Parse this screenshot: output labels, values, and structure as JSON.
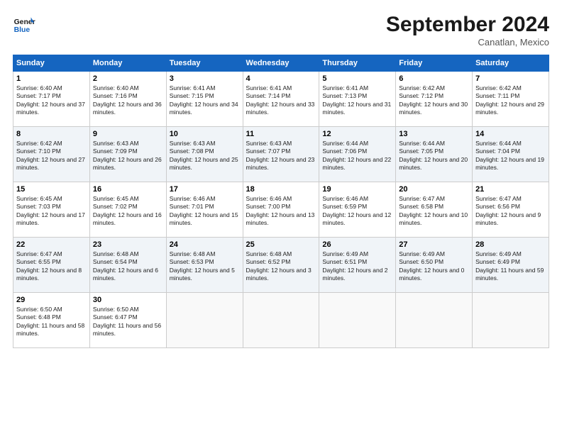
{
  "header": {
    "logo_line1": "General",
    "logo_line2": "Blue",
    "month": "September 2024",
    "location": "Canatlan, Mexico"
  },
  "weekdays": [
    "Sunday",
    "Monday",
    "Tuesday",
    "Wednesday",
    "Thursday",
    "Friday",
    "Saturday"
  ],
  "weeks": [
    [
      {
        "day": "1",
        "sunrise": "6:40 AM",
        "sunset": "7:17 PM",
        "daylight": "12 hours and 37 minutes."
      },
      {
        "day": "2",
        "sunrise": "6:40 AM",
        "sunset": "7:16 PM",
        "daylight": "12 hours and 36 minutes."
      },
      {
        "day": "3",
        "sunrise": "6:41 AM",
        "sunset": "7:15 PM",
        "daylight": "12 hours and 34 minutes."
      },
      {
        "day": "4",
        "sunrise": "6:41 AM",
        "sunset": "7:14 PM",
        "daylight": "12 hours and 33 minutes."
      },
      {
        "day": "5",
        "sunrise": "6:41 AM",
        "sunset": "7:13 PM",
        "daylight": "12 hours and 31 minutes."
      },
      {
        "day": "6",
        "sunrise": "6:42 AM",
        "sunset": "7:12 PM",
        "daylight": "12 hours and 30 minutes."
      },
      {
        "day": "7",
        "sunrise": "6:42 AM",
        "sunset": "7:11 PM",
        "daylight": "12 hours and 29 minutes."
      }
    ],
    [
      {
        "day": "8",
        "sunrise": "6:42 AM",
        "sunset": "7:10 PM",
        "daylight": "12 hours and 27 minutes."
      },
      {
        "day": "9",
        "sunrise": "6:43 AM",
        "sunset": "7:09 PM",
        "daylight": "12 hours and 26 minutes."
      },
      {
        "day": "10",
        "sunrise": "6:43 AM",
        "sunset": "7:08 PM",
        "daylight": "12 hours and 25 minutes."
      },
      {
        "day": "11",
        "sunrise": "6:43 AM",
        "sunset": "7:07 PM",
        "daylight": "12 hours and 23 minutes."
      },
      {
        "day": "12",
        "sunrise": "6:44 AM",
        "sunset": "7:06 PM",
        "daylight": "12 hours and 22 minutes."
      },
      {
        "day": "13",
        "sunrise": "6:44 AM",
        "sunset": "7:05 PM",
        "daylight": "12 hours and 20 minutes."
      },
      {
        "day": "14",
        "sunrise": "6:44 AM",
        "sunset": "7:04 PM",
        "daylight": "12 hours and 19 minutes."
      }
    ],
    [
      {
        "day": "15",
        "sunrise": "6:45 AM",
        "sunset": "7:03 PM",
        "daylight": "12 hours and 17 minutes."
      },
      {
        "day": "16",
        "sunrise": "6:45 AM",
        "sunset": "7:02 PM",
        "daylight": "12 hours and 16 minutes."
      },
      {
        "day": "17",
        "sunrise": "6:46 AM",
        "sunset": "7:01 PM",
        "daylight": "12 hours and 15 minutes."
      },
      {
        "day": "18",
        "sunrise": "6:46 AM",
        "sunset": "7:00 PM",
        "daylight": "12 hours and 13 minutes."
      },
      {
        "day": "19",
        "sunrise": "6:46 AM",
        "sunset": "6:59 PM",
        "daylight": "12 hours and 12 minutes."
      },
      {
        "day": "20",
        "sunrise": "6:47 AM",
        "sunset": "6:58 PM",
        "daylight": "12 hours and 10 minutes."
      },
      {
        "day": "21",
        "sunrise": "6:47 AM",
        "sunset": "6:56 PM",
        "daylight": "12 hours and 9 minutes."
      }
    ],
    [
      {
        "day": "22",
        "sunrise": "6:47 AM",
        "sunset": "6:55 PM",
        "daylight": "12 hours and 8 minutes."
      },
      {
        "day": "23",
        "sunrise": "6:48 AM",
        "sunset": "6:54 PM",
        "daylight": "12 hours and 6 minutes."
      },
      {
        "day": "24",
        "sunrise": "6:48 AM",
        "sunset": "6:53 PM",
        "daylight": "12 hours and 5 minutes."
      },
      {
        "day": "25",
        "sunrise": "6:48 AM",
        "sunset": "6:52 PM",
        "daylight": "12 hours and 3 minutes."
      },
      {
        "day": "26",
        "sunrise": "6:49 AM",
        "sunset": "6:51 PM",
        "daylight": "12 hours and 2 minutes."
      },
      {
        "day": "27",
        "sunrise": "6:49 AM",
        "sunset": "6:50 PM",
        "daylight": "12 hours and 0 minutes."
      },
      {
        "day": "28",
        "sunrise": "6:49 AM",
        "sunset": "6:49 PM",
        "daylight": "11 hours and 59 minutes."
      }
    ],
    [
      {
        "day": "29",
        "sunrise": "6:50 AM",
        "sunset": "6:48 PM",
        "daylight": "11 hours and 58 minutes."
      },
      {
        "day": "30",
        "sunrise": "6:50 AM",
        "sunset": "6:47 PM",
        "daylight": "11 hours and 56 minutes."
      },
      null,
      null,
      null,
      null,
      null
    ]
  ]
}
